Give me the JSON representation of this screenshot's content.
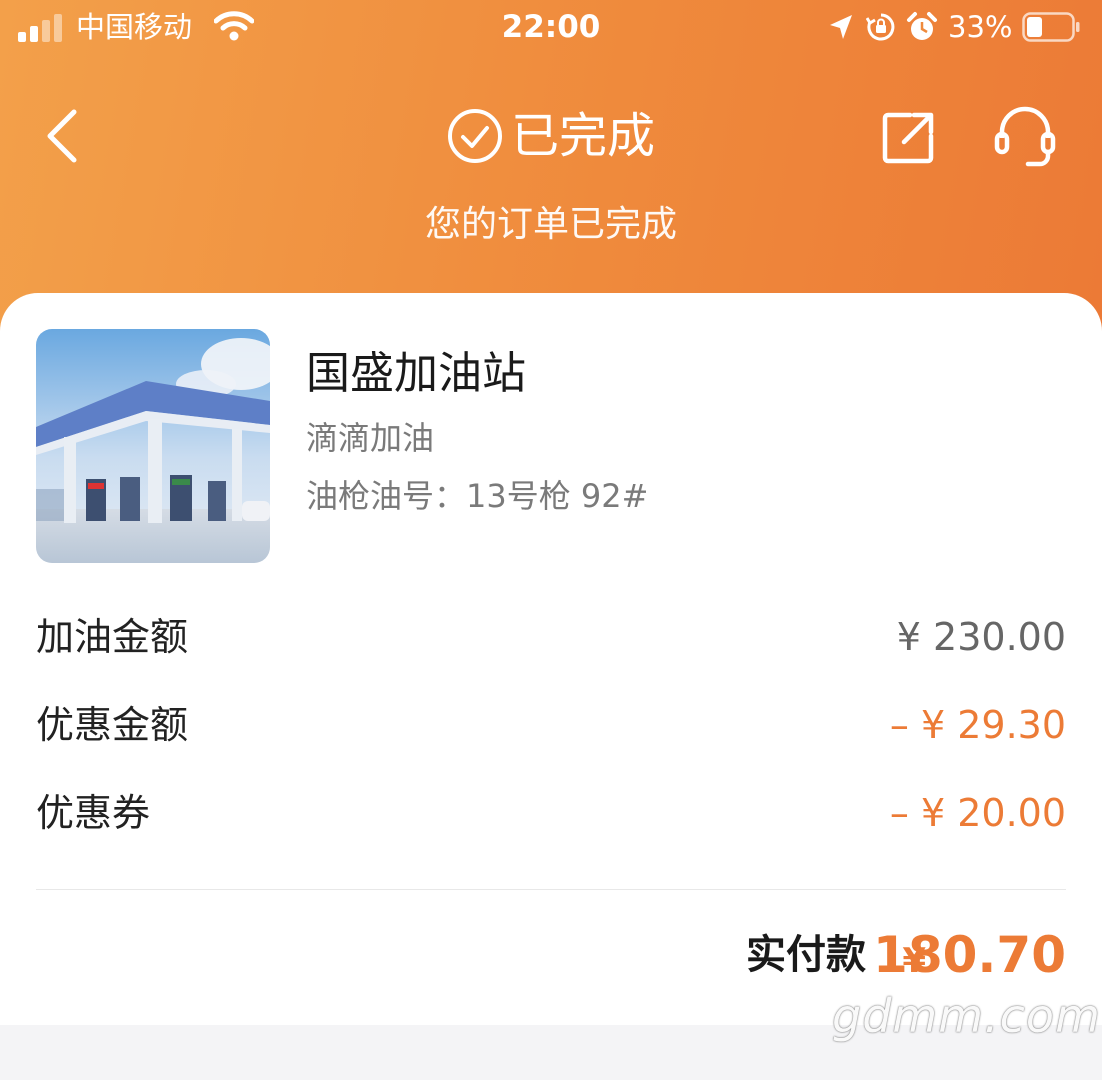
{
  "status_bar": {
    "carrier": "中国移动",
    "time": "22:00",
    "battery_percent": "33%"
  },
  "nav": {
    "title": "已完成",
    "subtitle": "您的订单已完成"
  },
  "station": {
    "name": "国盛加油站",
    "provider": "滴滴加油",
    "nozzle_info": "油枪油号：13号枪 92#"
  },
  "fees": [
    {
      "label": "加油金额",
      "value": "¥ 230.00"
    },
    {
      "label": "优惠金额",
      "value": "– ¥ 29.30"
    },
    {
      "label": "优惠券",
      "value": "– ¥ 20.00"
    }
  ],
  "total": {
    "label": "实付款",
    "currency": "¥",
    "amount": "180.70"
  },
  "watermark": "gdmm.com",
  "colors": {
    "accent": "#ec7b36",
    "header_start": "#f3a04a",
    "header_end": "#ec7a36"
  }
}
